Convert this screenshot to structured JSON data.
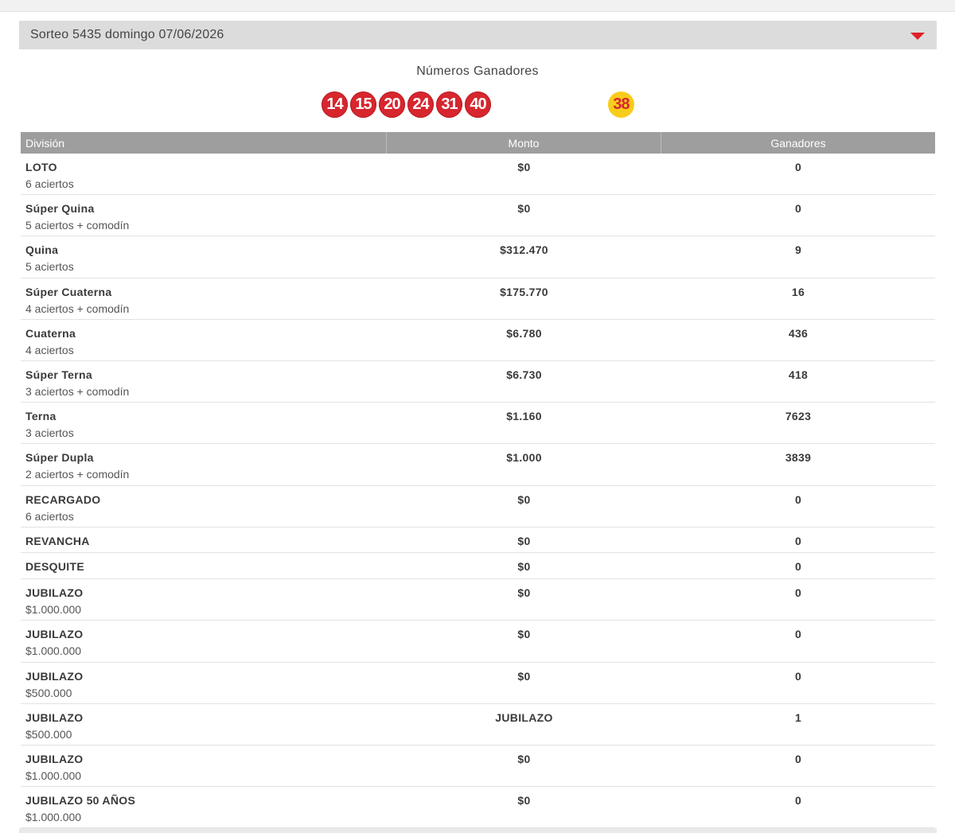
{
  "draw": {
    "title": "Sorteo 5435 domingo 07/06/2026"
  },
  "winners": {
    "title": "Números Ganadores",
    "numbers": [
      "14",
      "15",
      "20",
      "24",
      "31",
      "40"
    ],
    "joker": "38"
  },
  "table": {
    "headers": {
      "division": "División",
      "amount": "Monto",
      "winners": "Ganadores"
    },
    "rows": [
      {
        "name": "LOTO",
        "sub": "6 aciertos",
        "amount": "$0",
        "winners": "0"
      },
      {
        "name": "Súper Quina",
        "sub": "5 aciertos + comodín",
        "amount": "$0",
        "winners": "0"
      },
      {
        "name": "Quina",
        "sub": "5 aciertos",
        "amount": "$312.470",
        "winners": "9"
      },
      {
        "name": "Súper Cuaterna",
        "sub": "4 aciertos + comodín",
        "amount": "$175.770",
        "winners": "16"
      },
      {
        "name": "Cuaterna",
        "sub": "4 aciertos",
        "amount": "$6.780",
        "winners": "436"
      },
      {
        "name": "Súper Terna",
        "sub": "3 aciertos + comodín",
        "amount": "$6.730",
        "winners": "418"
      },
      {
        "name": "Terna",
        "sub": "3 aciertos",
        "amount": "$1.160",
        "winners": "7623"
      },
      {
        "name": "Súper Dupla",
        "sub": "2 aciertos + comodín",
        "amount": "$1.000",
        "winners": "3839"
      },
      {
        "name": "RECARGADO",
        "sub": "6 aciertos",
        "amount": "$0",
        "winners": "0"
      },
      {
        "name": "REVANCHA",
        "sub": "",
        "amount": "$0",
        "winners": "0"
      },
      {
        "name": "DESQUITE",
        "sub": "",
        "amount": "$0",
        "winners": "0"
      },
      {
        "name": "JUBILAZO",
        "sub": "$1.000.000",
        "amount": "$0",
        "winners": "0"
      },
      {
        "name": "JUBILAZO",
        "sub": "$1.000.000",
        "amount": "$0",
        "winners": "0"
      },
      {
        "name": "JUBILAZO",
        "sub": "$500.000",
        "amount": "$0",
        "winners": "0"
      },
      {
        "name": "JUBILAZO",
        "sub": "$500.000",
        "amount": "JUBILAZO",
        "winners": "1"
      },
      {
        "name": "JUBILAZO",
        "sub": "$1.000.000",
        "amount": "$0",
        "winners": "0"
      },
      {
        "name": "JUBILAZO 50 AÑOS",
        "sub": "$1.000.000",
        "amount": "$0",
        "winners": "0"
      }
    ]
  },
  "colors": {
    "ball_red": "#d7262e",
    "ball_yellow": "#f8cc1b",
    "header_gray": "#9e9e9e",
    "caret_red": "#e0202a"
  },
  "icons": {
    "toggle": "caret-down-icon"
  }
}
